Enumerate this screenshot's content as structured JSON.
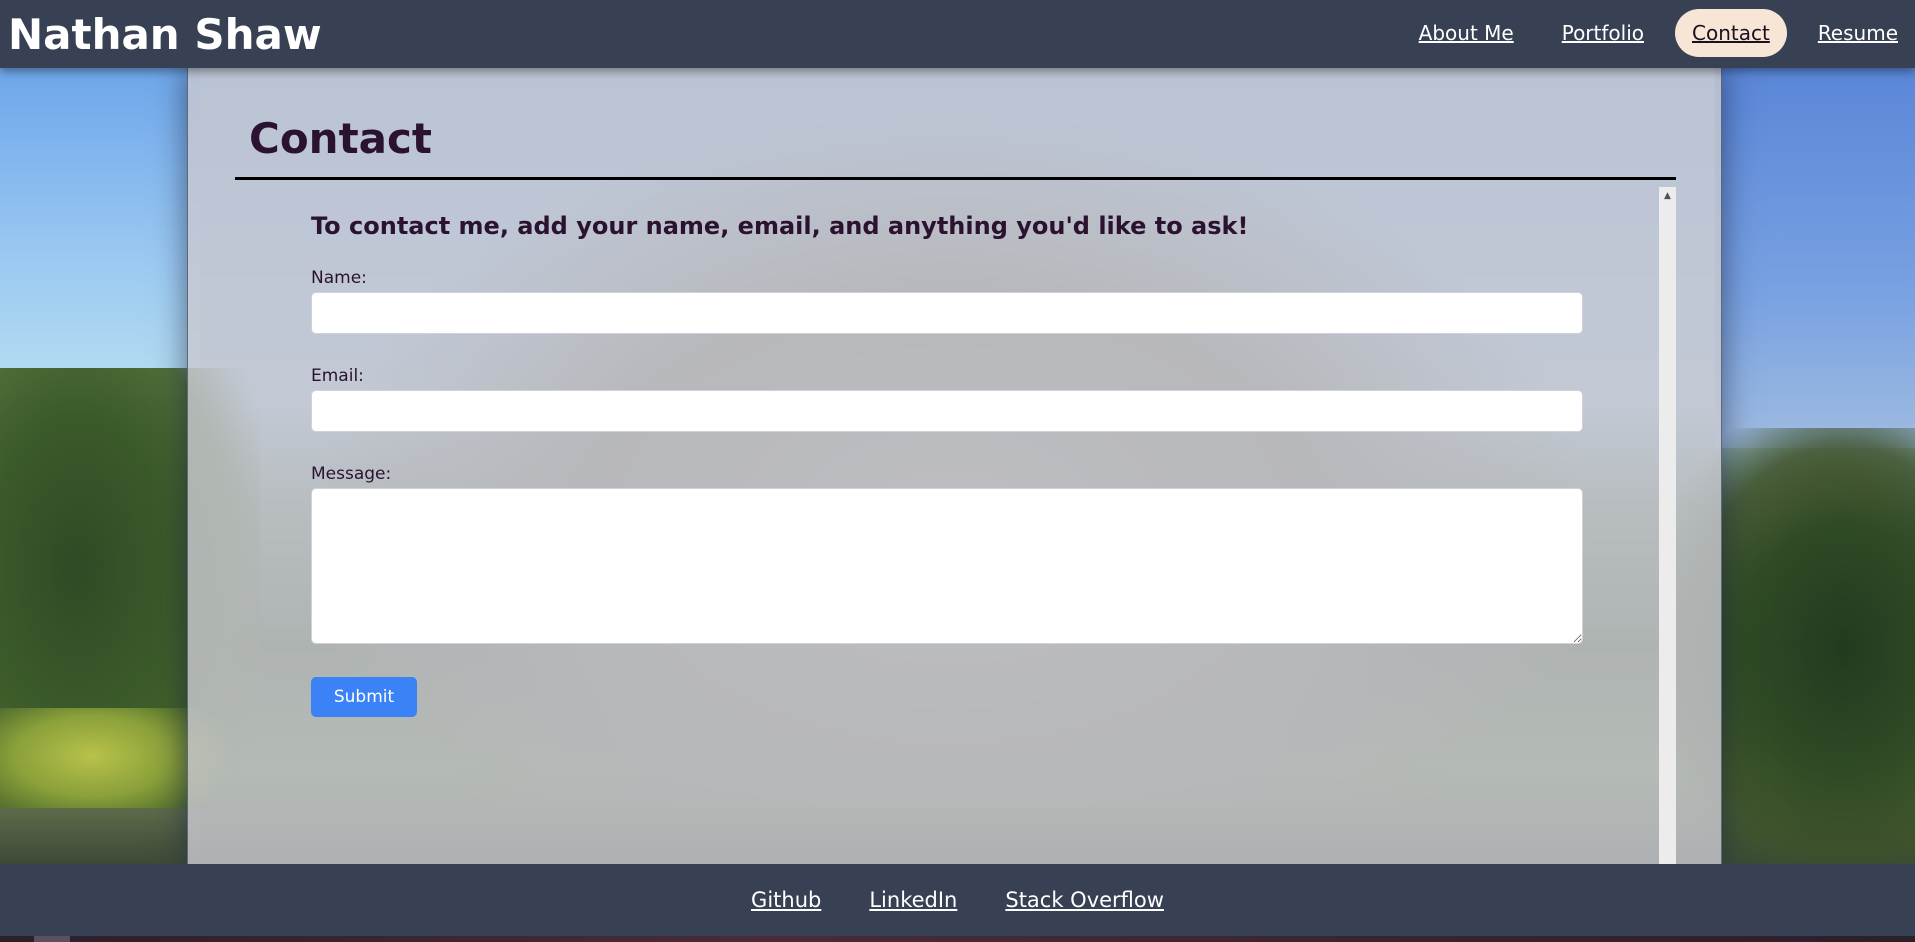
{
  "header": {
    "brand": "Nathan Shaw",
    "nav": [
      {
        "label": "About Me",
        "active": false
      },
      {
        "label": "Portfolio",
        "active": false
      },
      {
        "label": "Contact",
        "active": true
      },
      {
        "label": "Resume",
        "active": false
      }
    ]
  },
  "main": {
    "title": "Contact",
    "lead": "To contact me, add your name, email, and anything you'd like to ask!",
    "form": {
      "name_label": "Name:",
      "name_value": "",
      "email_label": "Email:",
      "email_value": "",
      "message_label": "Message:",
      "message_value": "",
      "submit_label": "Submit"
    }
  },
  "footer": {
    "links": [
      "Github",
      "LinkedIn",
      "Stack Overflow"
    ]
  },
  "colors": {
    "bar_bg": "#374153",
    "active_pill": "#f7e6d6",
    "submit_bg": "#3b82f6",
    "heading_text": "#2a1230"
  }
}
